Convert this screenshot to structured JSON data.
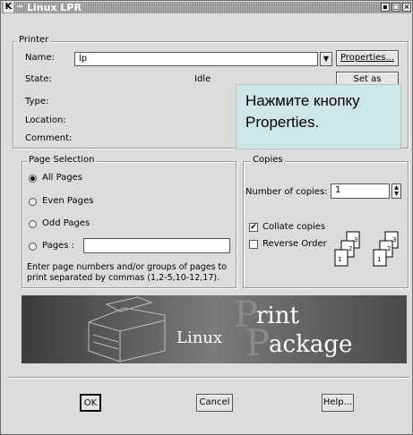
{
  "window": {
    "title": "Linux LPR",
    "app_icon": "K",
    "controls": [
      "▪",
      "□",
      "×"
    ]
  },
  "printer": {
    "group_label": "Printer",
    "name_label": "Name:",
    "name_value": "lp",
    "state_label": "State:",
    "state_value": "Idle",
    "type_label": "Type:",
    "location_label": "Location:",
    "comment_label": "Comment:",
    "properties_button": "Properties...",
    "set_default_button": "Set as Default"
  },
  "tooltip": {
    "text_line1": "Нажмите кнопку",
    "text_line2": "Properties."
  },
  "page_selection": {
    "group_label": "Page Selection",
    "all_pages": "All Pages",
    "even_pages": "Even Pages",
    "odd_pages": "Odd Pages",
    "pages": "Pages :",
    "pages_value": "",
    "hint_line1": "Enter page numbers and/or groups of pages to",
    "hint_line2": "print separated by commas (1,2-5,10-12,17).",
    "selected": "all_pages"
  },
  "copies": {
    "group_label": "Copies",
    "number_label": "Number of copies:",
    "number_value": "1",
    "collate_label": "Collate copies",
    "collate_checked": true,
    "reverse_label": "Reverse Order",
    "reverse_checked": false
  },
  "banner": {
    "linux": "Linux",
    "print_p": "P",
    "print_rest": "rint",
    "package_p": "P",
    "package_rest": "ackage"
  },
  "buttons": {
    "ok": "OK",
    "cancel": "Cancel",
    "help": "Help..."
  }
}
